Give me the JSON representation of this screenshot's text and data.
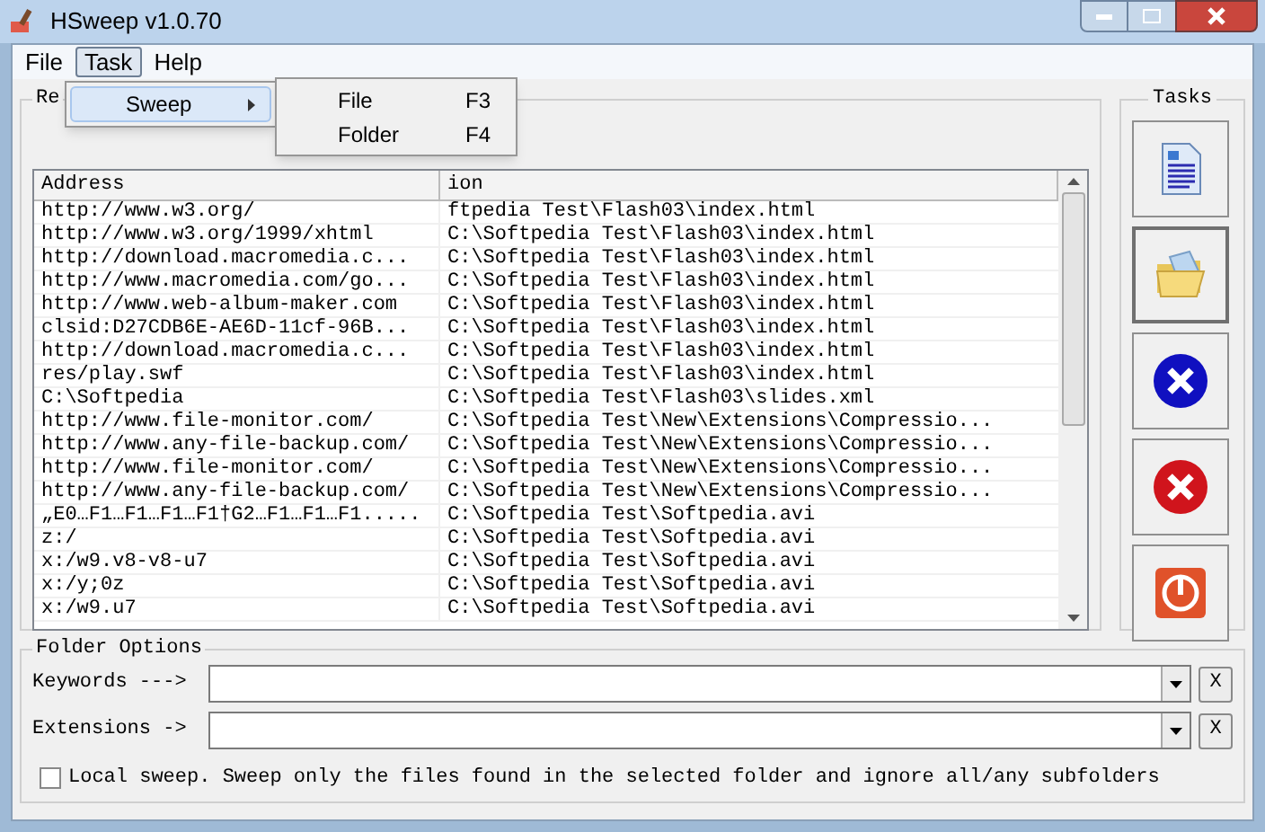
{
  "window": {
    "title": "HSweep v1.0.70"
  },
  "menu_bar": [
    {
      "label": "File",
      "selected": false
    },
    {
      "label": "Task",
      "selected": true
    },
    {
      "label": "Help",
      "selected": false
    }
  ],
  "task_menu": [
    {
      "label": "Sweep",
      "selected": true
    }
  ],
  "sweep_submenu": [
    {
      "label": "File",
      "shortcut": "F3"
    },
    {
      "label": "Folder",
      "shortcut": "F4"
    }
  ],
  "results": {
    "title": "Re",
    "columns": [
      "Address",
      "ion"
    ],
    "rows": [
      [
        "http://www.w3.org/",
        "ftpedia Test\\Flash03\\index.html"
      ],
      [
        "http://www.w3.org/1999/xhtml",
        "C:\\Softpedia Test\\Flash03\\index.html"
      ],
      [
        "http://download.macromedia.c...",
        "C:\\Softpedia Test\\Flash03\\index.html"
      ],
      [
        "http://www.macromedia.com/go...",
        "C:\\Softpedia Test\\Flash03\\index.html"
      ],
      [
        "http://www.web-album-maker.com",
        "C:\\Softpedia Test\\Flash03\\index.html"
      ],
      [
        "clsid:D27CDB6E-AE6D-11cf-96B...",
        "C:\\Softpedia Test\\Flash03\\index.html"
      ],
      [
        "http://download.macromedia.c...",
        "C:\\Softpedia Test\\Flash03\\index.html"
      ],
      [
        "res/play.swf",
        "C:\\Softpedia Test\\Flash03\\index.html"
      ],
      [
        "C:\\Softpedia",
        "C:\\Softpedia Test\\Flash03\\slides.xml"
      ],
      [
        "http://www.file-monitor.com/",
        "C:\\Softpedia Test\\New\\Extensions\\Compressio..."
      ],
      [
        "http://www.any-file-backup.com/",
        "C:\\Softpedia Test\\New\\Extensions\\Compressio..."
      ],
      [
        "http://www.file-monitor.com/",
        "C:\\Softpedia Test\\New\\Extensions\\Compressio..."
      ],
      [
        "http://www.any-file-backup.com/",
        "C:\\Softpedia Test\\New\\Extensions\\Compressio..."
      ],
      [
        "„E0…F1…F1…F1…F1†G2…F1…F1…F1.....",
        "C:\\Softpedia Test\\Softpedia.avi"
      ],
      [
        "z:/",
        "C:\\Softpedia Test\\Softpedia.avi"
      ],
      [
        "x:/w9.v8-v8-u7",
        "C:\\Softpedia Test\\Softpedia.avi"
      ],
      [
        "x:/y;0z",
        "C:\\Softpedia Test\\Softpedia.avi"
      ],
      [
        "x:/w9.u7",
        "C:\\Softpedia Test\\Softpedia.avi"
      ]
    ]
  },
  "tasks": {
    "title": "Tasks",
    "buttons": [
      {
        "kind": "document",
        "selected": false
      },
      {
        "kind": "folder",
        "selected": true
      },
      {
        "kind": "blue-x",
        "selected": false
      },
      {
        "kind": "red-x",
        "selected": false
      },
      {
        "kind": "power",
        "selected": false
      }
    ]
  },
  "folder_options": {
    "title": "Folder Options",
    "fields": [
      {
        "label": "Keywords --->",
        "clear": "X"
      },
      {
        "label": "Extensions ->",
        "clear": "X"
      }
    ],
    "local_sweep": {
      "label": "Local sweep. Sweep only the files found in the selected folder and ignore all/any subfolders",
      "checked": false
    }
  }
}
